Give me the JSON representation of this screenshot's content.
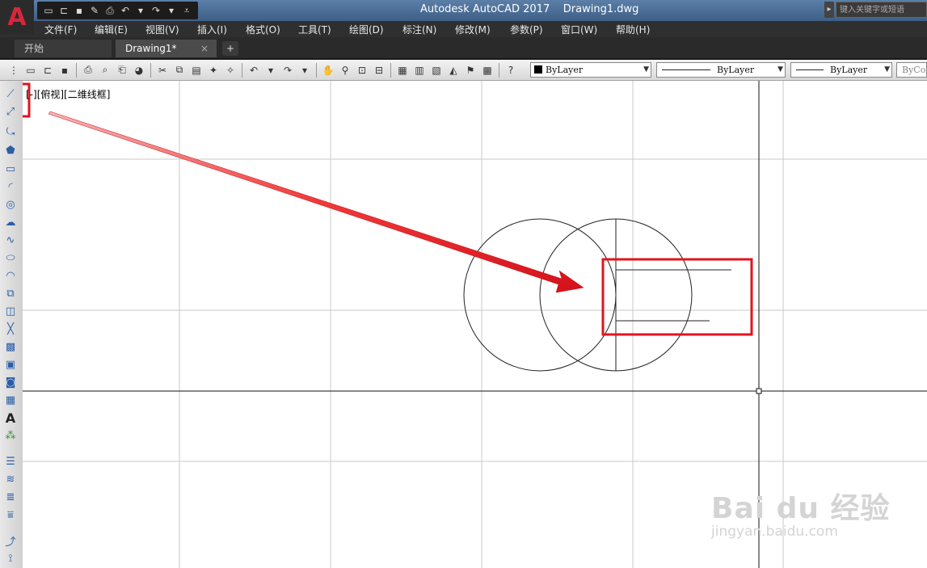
{
  "window": {
    "title": "Autodesk AutoCAD 2017    Drawing1.dwg",
    "search_placeholder": "键入关键字或短语"
  },
  "app_button": {
    "logo": "A"
  },
  "menu": {
    "items": [
      "文件(F)",
      "编辑(E)",
      "视图(V)",
      "插入(I)",
      "格式(O)",
      "工具(T)",
      "绘图(D)",
      "标注(N)",
      "修改(M)",
      "参数(P)",
      "窗口(W)",
      "帮助(H)"
    ]
  },
  "tabs": {
    "start": "开始",
    "active": "Drawing1*",
    "close": "×",
    "add": "+"
  },
  "toolbar": {
    "layer_color": "ByLayer",
    "linetype": "ByLayer",
    "lineweight": "ByLayer",
    "plot_style": "ByCol"
  },
  "viewport": {
    "label": "[-][俯视][二维线框]"
  },
  "watermark": {
    "brand": "Bai du 经验",
    "url": "jingyan.baidu.com"
  },
  "colors": {
    "highlight_red": "#e0141e",
    "grid": "#c8c8c8",
    "ink": "#222222"
  },
  "icons": {
    "left_toolbar": [
      "line-icon",
      "construction-line-icon",
      "polyline-icon",
      "polygon-icon",
      "rectangle-icon",
      "arc-icon",
      "circle-icon",
      "revision-cloud-icon",
      "spline-icon",
      "ellipse-icon",
      "ellipse-arc-icon",
      "insert-block-icon",
      "make-block-icon",
      "point-icon",
      "hatch-icon",
      "gradient-icon",
      "region-icon",
      "table-icon",
      "multiline-text-icon",
      "add-selected-icon"
    ]
  }
}
